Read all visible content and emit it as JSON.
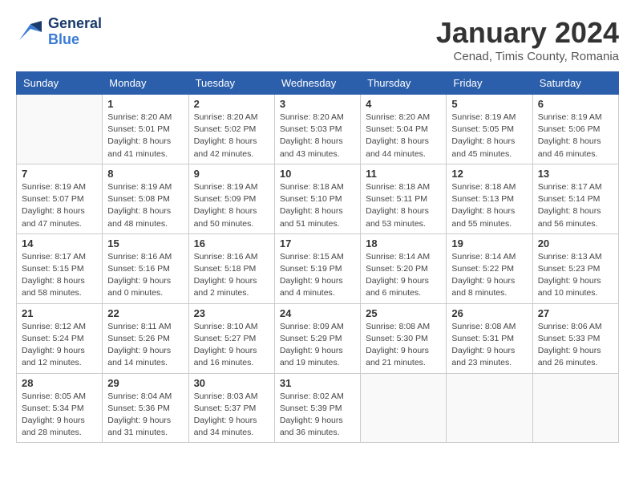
{
  "header": {
    "logo_general": "General",
    "logo_blue": "Blue",
    "month_title": "January 2024",
    "location": "Cenad, Timis County, Romania"
  },
  "days_of_week": [
    "Sunday",
    "Monday",
    "Tuesday",
    "Wednesday",
    "Thursday",
    "Friday",
    "Saturday"
  ],
  "weeks": [
    [
      {
        "day": "",
        "info": ""
      },
      {
        "day": "1",
        "info": "Sunrise: 8:20 AM\nSunset: 5:01 PM\nDaylight: 8 hours\nand 41 minutes."
      },
      {
        "day": "2",
        "info": "Sunrise: 8:20 AM\nSunset: 5:02 PM\nDaylight: 8 hours\nand 42 minutes."
      },
      {
        "day": "3",
        "info": "Sunrise: 8:20 AM\nSunset: 5:03 PM\nDaylight: 8 hours\nand 43 minutes."
      },
      {
        "day": "4",
        "info": "Sunrise: 8:20 AM\nSunset: 5:04 PM\nDaylight: 8 hours\nand 44 minutes."
      },
      {
        "day": "5",
        "info": "Sunrise: 8:19 AM\nSunset: 5:05 PM\nDaylight: 8 hours\nand 45 minutes."
      },
      {
        "day": "6",
        "info": "Sunrise: 8:19 AM\nSunset: 5:06 PM\nDaylight: 8 hours\nand 46 minutes."
      }
    ],
    [
      {
        "day": "7",
        "info": "Sunrise: 8:19 AM\nSunset: 5:07 PM\nDaylight: 8 hours\nand 47 minutes."
      },
      {
        "day": "8",
        "info": "Sunrise: 8:19 AM\nSunset: 5:08 PM\nDaylight: 8 hours\nand 48 minutes."
      },
      {
        "day": "9",
        "info": "Sunrise: 8:19 AM\nSunset: 5:09 PM\nDaylight: 8 hours\nand 50 minutes."
      },
      {
        "day": "10",
        "info": "Sunrise: 8:18 AM\nSunset: 5:10 PM\nDaylight: 8 hours\nand 51 minutes."
      },
      {
        "day": "11",
        "info": "Sunrise: 8:18 AM\nSunset: 5:11 PM\nDaylight: 8 hours\nand 53 minutes."
      },
      {
        "day": "12",
        "info": "Sunrise: 8:18 AM\nSunset: 5:13 PM\nDaylight: 8 hours\nand 55 minutes."
      },
      {
        "day": "13",
        "info": "Sunrise: 8:17 AM\nSunset: 5:14 PM\nDaylight: 8 hours\nand 56 minutes."
      }
    ],
    [
      {
        "day": "14",
        "info": "Sunrise: 8:17 AM\nSunset: 5:15 PM\nDaylight: 8 hours\nand 58 minutes."
      },
      {
        "day": "15",
        "info": "Sunrise: 8:16 AM\nSunset: 5:16 PM\nDaylight: 9 hours\nand 0 minutes."
      },
      {
        "day": "16",
        "info": "Sunrise: 8:16 AM\nSunset: 5:18 PM\nDaylight: 9 hours\nand 2 minutes."
      },
      {
        "day": "17",
        "info": "Sunrise: 8:15 AM\nSunset: 5:19 PM\nDaylight: 9 hours\nand 4 minutes."
      },
      {
        "day": "18",
        "info": "Sunrise: 8:14 AM\nSunset: 5:20 PM\nDaylight: 9 hours\nand 6 minutes."
      },
      {
        "day": "19",
        "info": "Sunrise: 8:14 AM\nSunset: 5:22 PM\nDaylight: 9 hours\nand 8 minutes."
      },
      {
        "day": "20",
        "info": "Sunrise: 8:13 AM\nSunset: 5:23 PM\nDaylight: 9 hours\nand 10 minutes."
      }
    ],
    [
      {
        "day": "21",
        "info": "Sunrise: 8:12 AM\nSunset: 5:24 PM\nDaylight: 9 hours\nand 12 minutes."
      },
      {
        "day": "22",
        "info": "Sunrise: 8:11 AM\nSunset: 5:26 PM\nDaylight: 9 hours\nand 14 minutes."
      },
      {
        "day": "23",
        "info": "Sunrise: 8:10 AM\nSunset: 5:27 PM\nDaylight: 9 hours\nand 16 minutes."
      },
      {
        "day": "24",
        "info": "Sunrise: 8:09 AM\nSunset: 5:29 PM\nDaylight: 9 hours\nand 19 minutes."
      },
      {
        "day": "25",
        "info": "Sunrise: 8:08 AM\nSunset: 5:30 PM\nDaylight: 9 hours\nand 21 minutes."
      },
      {
        "day": "26",
        "info": "Sunrise: 8:08 AM\nSunset: 5:31 PM\nDaylight: 9 hours\nand 23 minutes."
      },
      {
        "day": "27",
        "info": "Sunrise: 8:06 AM\nSunset: 5:33 PM\nDaylight: 9 hours\nand 26 minutes."
      }
    ],
    [
      {
        "day": "28",
        "info": "Sunrise: 8:05 AM\nSunset: 5:34 PM\nDaylight: 9 hours\nand 28 minutes."
      },
      {
        "day": "29",
        "info": "Sunrise: 8:04 AM\nSunset: 5:36 PM\nDaylight: 9 hours\nand 31 minutes."
      },
      {
        "day": "30",
        "info": "Sunrise: 8:03 AM\nSunset: 5:37 PM\nDaylight: 9 hours\nand 34 minutes."
      },
      {
        "day": "31",
        "info": "Sunrise: 8:02 AM\nSunset: 5:39 PM\nDaylight: 9 hours\nand 36 minutes."
      },
      {
        "day": "",
        "info": ""
      },
      {
        "day": "",
        "info": ""
      },
      {
        "day": "",
        "info": ""
      }
    ]
  ]
}
